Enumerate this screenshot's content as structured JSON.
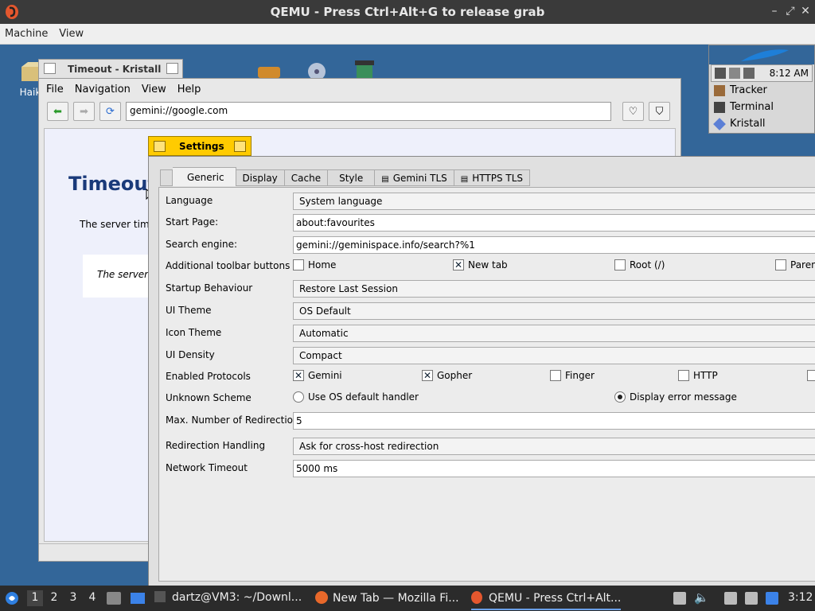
{
  "qemu": {
    "title": "QEMU - Press Ctrl+Alt+G to release grab",
    "menu": [
      "Machine",
      "View"
    ]
  },
  "desktop": {
    "icon_label": "Haik",
    "deskbar": {
      "time": "8:12 AM",
      "apps": [
        "Tracker",
        "Terminal",
        "Kristall"
      ]
    }
  },
  "kristall": {
    "title": "Timeout - Kristall",
    "menu": [
      "File",
      "Navigation",
      "View",
      "Help"
    ],
    "url": "gemini://google.com",
    "page_heading": "Timeout",
    "page_text": "The server timec",
    "page_quote": "The server di"
  },
  "settings": {
    "title": "Settings",
    "tabs": [
      "Generic",
      "Display",
      "Cache",
      "Style",
      "Gemini TLS",
      "HTTPS TLS"
    ],
    "rows": {
      "language": {
        "label": "Language",
        "value": "System language"
      },
      "start_page": {
        "label": "Start Page:",
        "value": "about:favourites"
      },
      "search_engine": {
        "label": "Search engine:",
        "value": "gemini://geminispace.info/search?%1"
      },
      "toolbar_buttons": {
        "label": "Additional toolbar buttons",
        "options": [
          {
            "label": "Home",
            "checked": false
          },
          {
            "label": "New tab",
            "checked": true
          },
          {
            "label": "Root (/)",
            "checked": false
          },
          {
            "label": "Parent",
            "checked": false
          }
        ]
      },
      "startup": {
        "label": "Startup Behaviour",
        "value": "Restore Last Session"
      },
      "ui_theme": {
        "label": "UI Theme",
        "value": "OS Default"
      },
      "icon_theme": {
        "label": "Icon Theme",
        "value": "Automatic"
      },
      "ui_density": {
        "label": "UI Density",
        "value": "Compact"
      },
      "protocols": {
        "label": "Enabled Protocols",
        "options": [
          {
            "label": "Gemini",
            "checked": true
          },
          {
            "label": "Gopher",
            "checked": true
          },
          {
            "label": "Finger",
            "checked": false
          },
          {
            "label": "HTTP",
            "checked": false
          }
        ]
      },
      "unknown_scheme": {
        "label": "Unknown Scheme",
        "options": [
          {
            "label": "Use OS default handler",
            "selected": false
          },
          {
            "label": "Display error message",
            "selected": true
          }
        ]
      },
      "max_redirects": {
        "label": "Max. Number of Redirections",
        "value": "5"
      },
      "redirect_handling": {
        "label": "Redirection Handling",
        "value": "Ask for cross-host redirection"
      },
      "network_timeout": {
        "label": "Network Timeout",
        "value": "5000 ms"
      }
    }
  },
  "taskbar": {
    "workspaces": [
      "1",
      "2",
      "3",
      "4"
    ],
    "tasks": [
      "dartz@VM3: ~/Downl...",
      "New Tab — Mozilla Fi...",
      "QEMU - Press Ctrl+Alt..."
    ],
    "clock": "3:12"
  },
  "colors": {
    "desktop": "#336699",
    "settings_tab": "#ffcb00",
    "heading": "#1a3a7a"
  }
}
